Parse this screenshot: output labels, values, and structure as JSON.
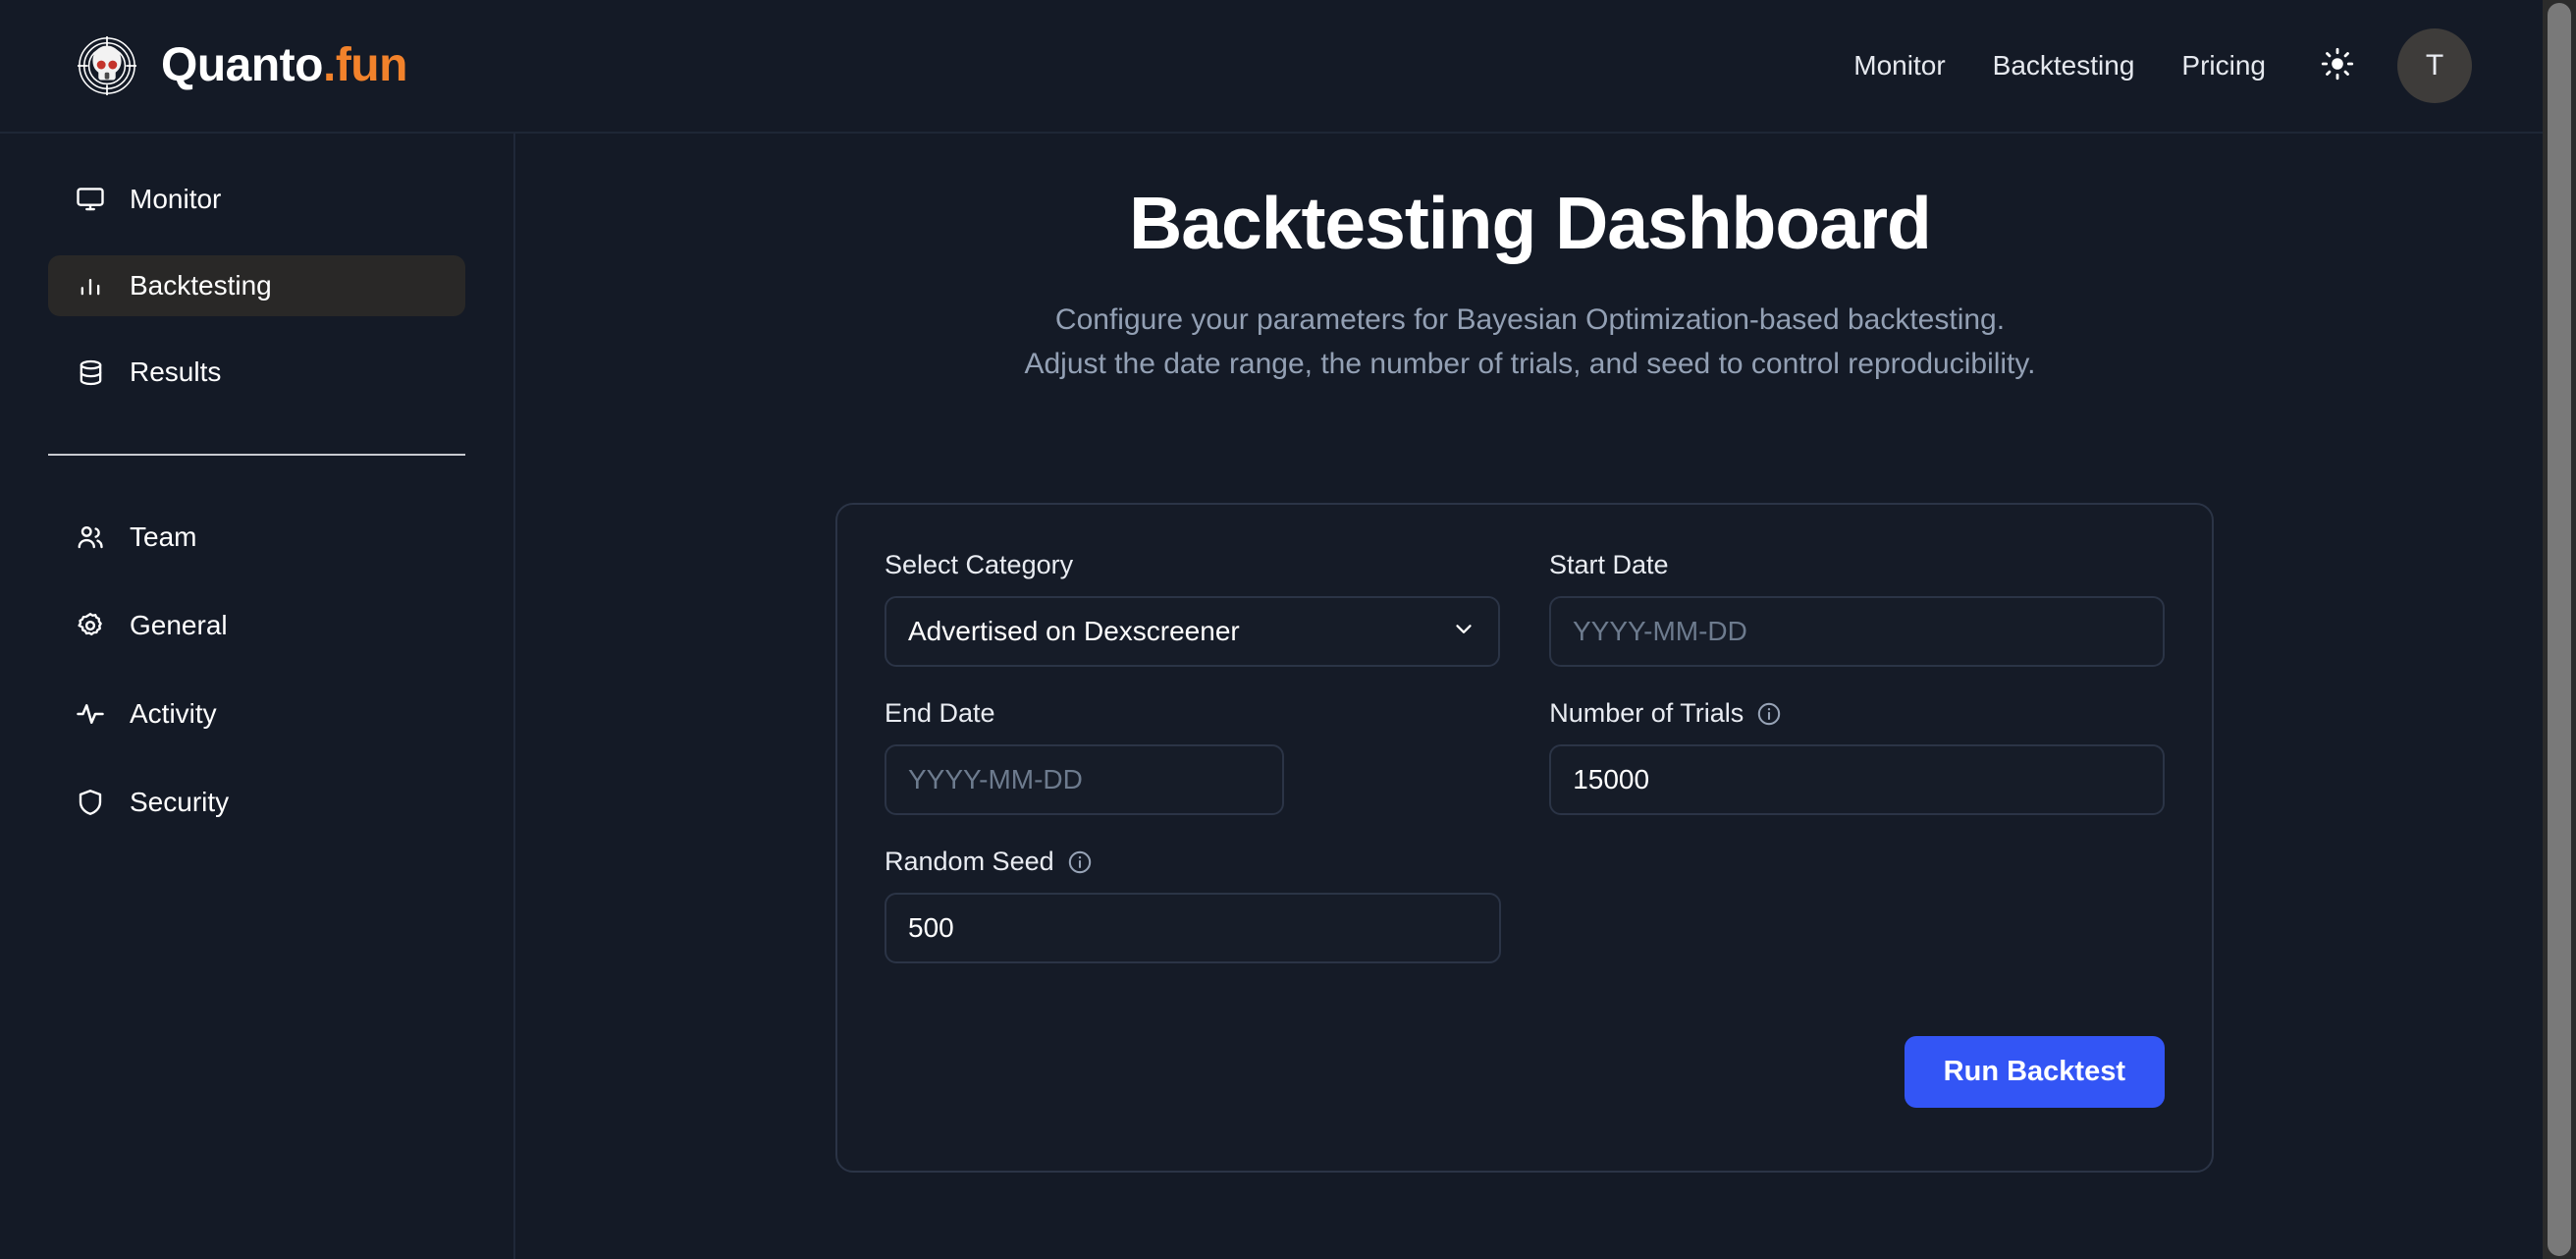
{
  "brand": {
    "name_primary": "Quanto",
    "name_suffix": ".fun",
    "logo_icon": "skull-target-icon",
    "accent_color": "#f2822b"
  },
  "topnav": {
    "items": [
      {
        "label": "Monitor"
      },
      {
        "label": "Backtesting"
      },
      {
        "label": "Pricing"
      }
    ],
    "theme_toggle_icon": "sun-icon",
    "avatar_initial": "T"
  },
  "sidebar": {
    "primary_items": [
      {
        "label": "Monitor",
        "icon": "monitor-icon",
        "active": false
      },
      {
        "label": "Backtesting",
        "icon": "bar-chart-icon",
        "active": true
      },
      {
        "label": "Results",
        "icon": "database-icon",
        "active": false
      }
    ],
    "secondary_items": [
      {
        "label": "Team",
        "icon": "users-icon"
      },
      {
        "label": "General",
        "icon": "gear-icon"
      },
      {
        "label": "Activity",
        "icon": "activity-pulse-icon"
      },
      {
        "label": "Security",
        "icon": "shield-icon"
      }
    ]
  },
  "main": {
    "title": "Backtesting Dashboard",
    "subtitle_line1": "Configure your parameters for Bayesian Optimization-based backtesting.",
    "subtitle_line2": "Adjust the date range, the number of trials, and seed to control reproducibility."
  },
  "form": {
    "category": {
      "label": "Select Category",
      "value": "Advertised on Dexscreener",
      "chevron_icon": "chevron-down-icon"
    },
    "start_date": {
      "label": "Start Date",
      "value": "",
      "placeholder": "YYYY-MM-DD"
    },
    "end_date": {
      "label": "End Date",
      "value": "",
      "placeholder": "YYYY-MM-DD"
    },
    "trials": {
      "label": "Number of Trials",
      "value": "15000",
      "info_icon": "info-circle-icon"
    },
    "seed": {
      "label": "Random Seed",
      "value": "500",
      "info_icon": "info-circle-icon"
    },
    "submit_label": "Run Backtest",
    "submit_color": "#3355f5"
  }
}
